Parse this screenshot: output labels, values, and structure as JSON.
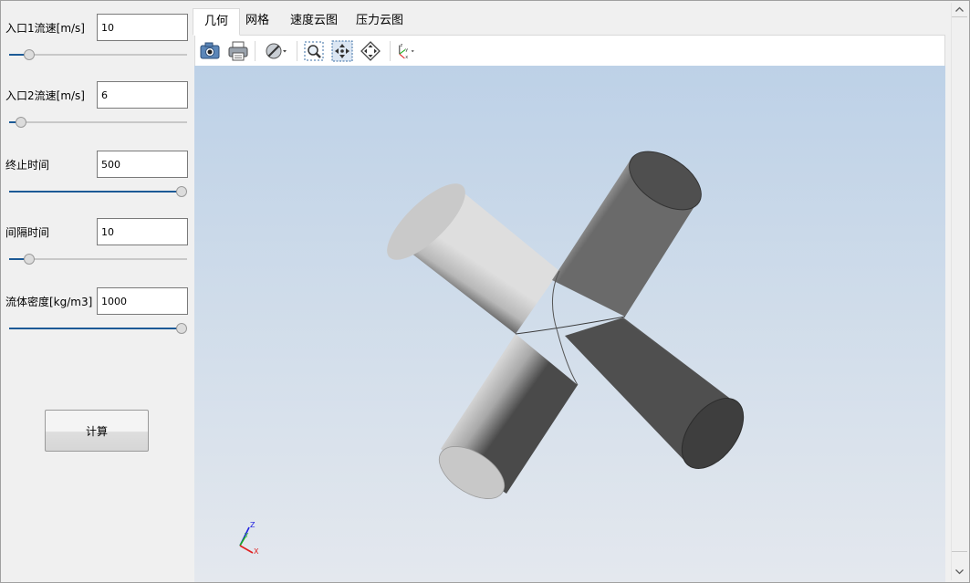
{
  "params": [
    {
      "label": "入口1流速[m/s]",
      "value": "10",
      "slider_fraction": 0.09
    },
    {
      "label": "入口2流速[m/s]",
      "value": "6",
      "slider_fraction": 0.04
    },
    {
      "label": "终止时间",
      "value": "500",
      "slider_fraction": 1.0
    },
    {
      "label": "间隔时间",
      "value": "10",
      "slider_fraction": 0.09
    },
    {
      "label": "流体密度[kg/m3]",
      "value": "1000",
      "slider_fraction": 1.0
    }
  ],
  "calc_button": "计算",
  "tabs": [
    "几何",
    "网格",
    "速度云图",
    "压力云图"
  ],
  "active_tab": 0,
  "toolbar": [
    "camera-icon",
    "print-icon",
    "display-mode-icon",
    "zoom-box-icon",
    "fit-all-icon",
    "fit-selection-icon",
    "axes-orientation-icon"
  ],
  "triad_labels": {
    "z": "Z",
    "y": "Y",
    "x": "X"
  },
  "colors": {
    "slider_fill": "#1c5a96",
    "viewport_top": "#bdd1e7",
    "viewport_bottom": "#e4e8ee",
    "axis_x": "#e02020",
    "axis_y": "#1eb01e",
    "axis_z": "#2020e0"
  }
}
